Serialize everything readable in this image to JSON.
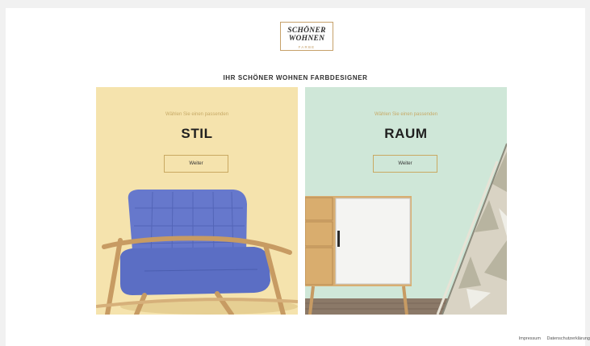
{
  "logo": {
    "line1": "SCHÖNER",
    "line2": "WOHNEN",
    "line3": "FARBE"
  },
  "headline": "IHR SCHÖNER WOHNEN FARBDESIGNER",
  "cards": [
    {
      "subtitle": "Wählen Sie einen passenden",
      "title": "STIL",
      "button": "Weiter"
    },
    {
      "subtitle": "Wählen Sie einen passenden",
      "title": "RAUM",
      "button": "Weiter"
    }
  ],
  "footer": {
    "impressum": "Impressum",
    "datenschutz": "Datenschutzerklärung"
  },
  "colors": {
    "stil_background": "#f5e3ad",
    "raum_background": "#cfe7d8",
    "accent_gold": "#c9a962",
    "chair_blue": "#5f73c9",
    "wood": "#c79b63"
  }
}
